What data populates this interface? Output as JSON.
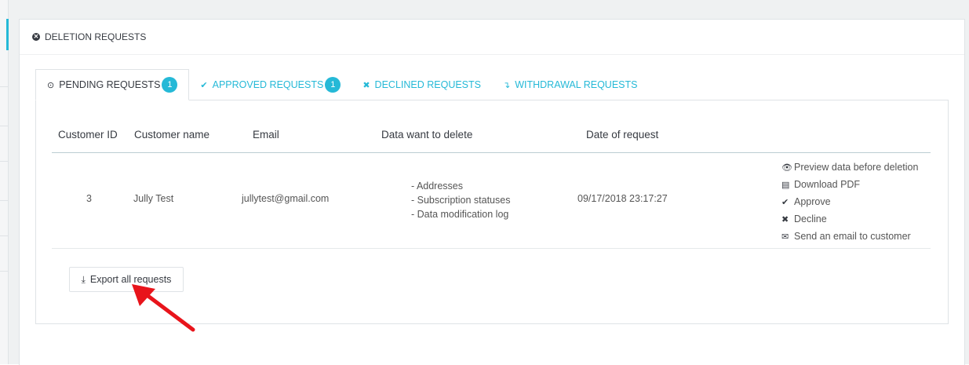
{
  "panel": {
    "title": "DELETION REQUESTS",
    "icon": "close-circle-icon"
  },
  "tabs": [
    {
      "label": "PENDING REQUESTS",
      "badge": "1",
      "icon": "clock-icon",
      "active": true
    },
    {
      "label": "APPROVED REQUESTS",
      "badge": "1",
      "icon": "check-icon",
      "active": false
    },
    {
      "label": "DECLINED REQUESTS",
      "badge": "",
      "icon": "x-icon",
      "active": false
    },
    {
      "label": "WITHDRAWAL REQUESTS",
      "badge": "",
      "icon": "arrow-down-icon",
      "active": false
    }
  ],
  "table": {
    "headers": [
      "Customer ID",
      "Customer name",
      "Email",
      "Data want to delete",
      "Date of request"
    ],
    "rows": [
      {
        "customer_id": "3",
        "customer_name": "Jully Test",
        "email": "jullytest@gmail.com",
        "data_to_delete": [
          "- Addresses",
          "- Subscription statuses",
          "- Data modification log"
        ],
        "date": "09/17/2018 23:17:27",
        "actions": [
          {
            "label": "Preview data before deletion",
            "icon": "eye-icon"
          },
          {
            "label": "Download PDF",
            "icon": "file-icon"
          },
          {
            "label": "Approve",
            "icon": "check-icon"
          },
          {
            "label": "Decline",
            "icon": "x-icon"
          },
          {
            "label": "Send an email to customer",
            "icon": "envelope-icon"
          }
        ]
      }
    ]
  },
  "export_button": {
    "label": "Export all requests",
    "icon": "download-icon"
  },
  "colors": {
    "accent": "#25b9d7",
    "annotation_arrow": "#e8141b"
  }
}
